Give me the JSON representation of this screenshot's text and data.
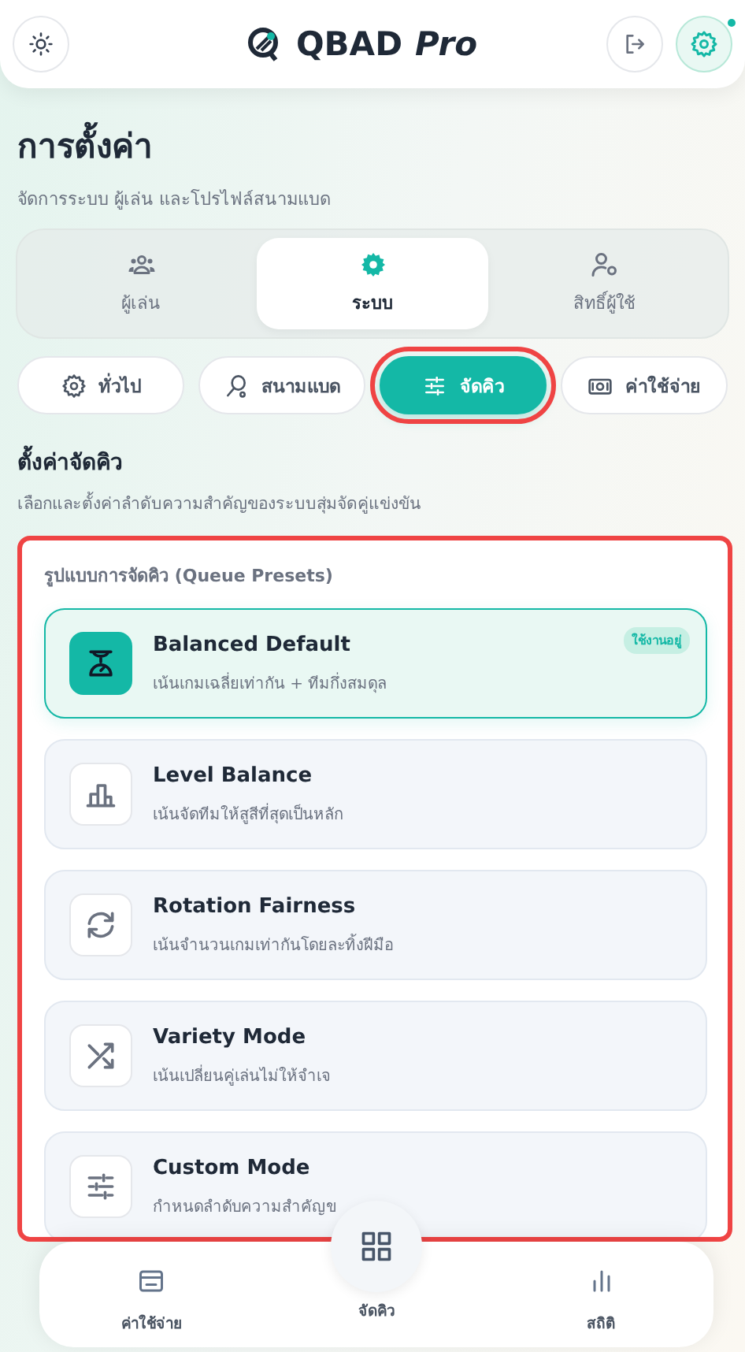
{
  "header": {
    "logo_text": "QBAD",
    "logo_suffix": "Pro",
    "settings_notification": true
  },
  "page": {
    "title": "การตั้งค่า",
    "subtitle": "จัดการระบบ ผู้เล่น และโปรไฟล์สนามแบด"
  },
  "main_tabs": [
    {
      "label": "ผู้เล่น",
      "selected": false
    },
    {
      "label": "ระบบ",
      "selected": true
    },
    {
      "label": "สิทธิ์ผู้ใช้",
      "selected": false
    }
  ],
  "sub_tabs": [
    {
      "label": "ทั่วไป",
      "selected": false,
      "highlighted": false
    },
    {
      "label": "สนามแบด",
      "selected": false,
      "highlighted": false
    },
    {
      "label": "จัดคิว",
      "selected": true,
      "highlighted": true
    },
    {
      "label": "ค่าใช้จ่าย",
      "selected": false,
      "highlighted": false
    }
  ],
  "section": {
    "title": "ตั้งค่าจัดคิว",
    "description": "เลือกและตั้งค่าลำดับความสำคัญของระบบสุ่มจัดคู่แข่งขัน"
  },
  "presets_panel": {
    "highlighted": true,
    "heading": "รูปแบบการจัดคิว (Queue Presets)",
    "presets": [
      {
        "name": "Balanced Default",
        "description": "เน้นเกมเฉลี่ยเท่ากัน + ทีมกึ่งสมดุล",
        "selected": true,
        "badge": "ใช้งานอยู่"
      },
      {
        "name": "Level Balance",
        "description": "เน้นจัดทีมให้สูสีที่สุดเป็นหลัก",
        "selected": false
      },
      {
        "name": "Rotation Fairness",
        "description": "เน้นจำนวนเกมเท่ากันโดยละทิ้งฝีมือ",
        "selected": false
      },
      {
        "name": "Variety Mode",
        "description": "เน้นเปลี่ยนคู่เล่นไม่ให้จำเจ",
        "selected": false
      },
      {
        "name": "Custom Mode",
        "description": "กำหนดลำดับความสำคัญข",
        "selected": false
      }
    ]
  },
  "bottom_nav": [
    {
      "label": "ค่าใช้จ่าย",
      "kind": "side"
    },
    {
      "label": "จัดคิว",
      "kind": "center"
    },
    {
      "label": "สถิติ",
      "kind": "side"
    }
  ]
}
